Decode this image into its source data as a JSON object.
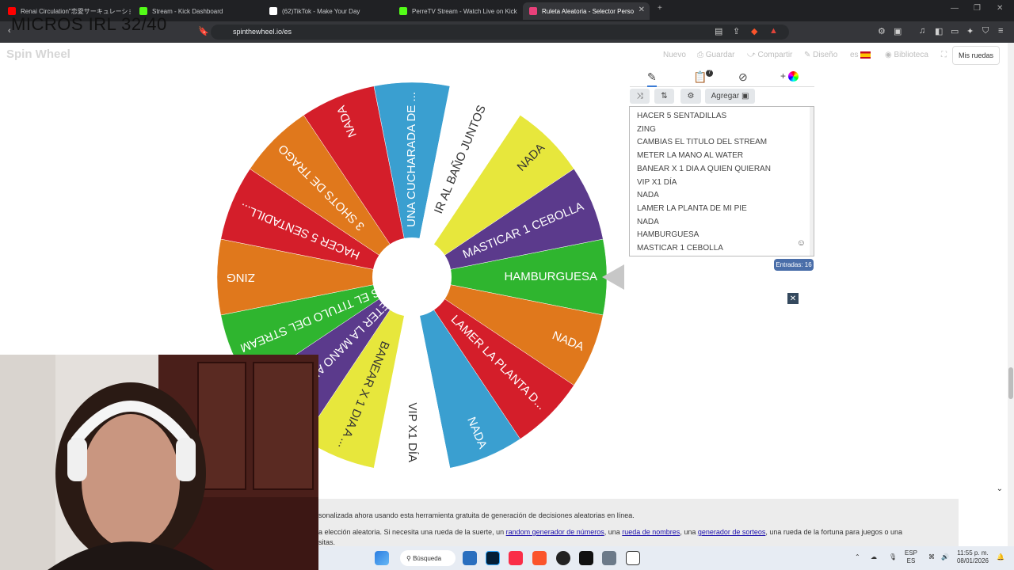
{
  "overlay_title": "MICROS IRL 32/40",
  "browser": {
    "tabs": [
      {
        "label": "Renai Circulation\"恋愛サーキュレーション",
        "color": "#ff0000"
      },
      {
        "label": "Stream - Kick Dashboard",
        "color": "#53fc18"
      },
      {
        "label": "(62)TikTok - Make Your Day",
        "color": "#ffffff"
      },
      {
        "label": "PerreTV Stream - Watch Live on Kick",
        "color": "#53fc18"
      },
      {
        "label": "Ruleta Aleatoria - Selector Perso",
        "color": "#e9407a",
        "active": true
      }
    ],
    "url": "spinthewheel.io/es"
  },
  "site": {
    "logo": "Spin Wheel",
    "nav": [
      "Nuevo",
      "Guardar",
      "Compartir",
      "Diseño",
      "es",
      "Biblioteca"
    ],
    "mis_ruedas": "Mis ruedas"
  },
  "wheel": {
    "segments": [
      {
        "label": "HAMBURGUESA",
        "color": "#2fb52f"
      },
      {
        "label": "NADA",
        "color": "#e0781c"
      },
      {
        "label": "LAMER LA PLANTA D...",
        "color": "#d41e2a"
      },
      {
        "label": "NADA",
        "color": "#3a9fd0"
      },
      {
        "label": "VIP X1 DÍA",
        "color": "#ffffff"
      },
      {
        "label": "BANEAR X 1 DIA A ...",
        "color": "#e7e73c"
      },
      {
        "label": "METER LA MANO AL WATER",
        "color": "#5b3a8c"
      },
      {
        "label": "CAMBIAS EL TITULO DEL STREAM",
        "color": "#2fb52f"
      },
      {
        "label": "ZING",
        "color": "#e0781c"
      },
      {
        "label": "HACER 5 SENTADILL...",
        "color": "#d41e2a"
      },
      {
        "label": "3 SHOTS DE TRAGO",
        "color": "#e0781c"
      },
      {
        "label": "NADA",
        "color": "#d41e2a"
      },
      {
        "label": "UNA CUCHARADA DE ...",
        "color": "#3a9fd0"
      },
      {
        "label": "IR AL BAÑO JUNTOS",
        "color": "#ffffff"
      },
      {
        "label": "NADA",
        "color": "#e7e73c"
      },
      {
        "label": "MASTICAR 1 CEBOLLA",
        "color": "#5b3a8c"
      }
    ]
  },
  "panel": {
    "badge": "7",
    "agregar": "Agregar",
    "entries": [
      "HACER 5 SENTADILLAS",
      "ZING",
      "CAMBIAS EL TITULO DEL STREAM",
      "METER LA MANO AL WATER",
      "BANEAR X 1 DIA A QUIEN QUIERAN",
      "VIP X1 DÍA",
      "NADA",
      "LAMER LA PLANTA DE MI PIE",
      "NADA",
      "HAMBURGUESA",
      "MASTICAR 1 CEBOLLA"
    ],
    "entries_count": "Entradas: 16"
  },
  "bottom": {
    "line1": "sonalizada ahora usando esta herramienta gratuita de generación de decisiones aleatorias en línea.",
    "line2_pre": "a elección aleatoria. Si necesita una rueda de la suerte, un ",
    "link1": "random generador de números",
    "mid1": ", una ",
    "link2": "rueda de nombres",
    "mid2": ", una ",
    "link3": "generador de sorteos",
    "line2_post": ", una rueda de la fortuna para juegos o una",
    "line3": "sitas."
  },
  "taskbar": {
    "search": "Búsqueda",
    "lang_top": "ESP",
    "lang_bot": "ES",
    "time": "11:55 p. m.",
    "date": "08/01/2026"
  }
}
